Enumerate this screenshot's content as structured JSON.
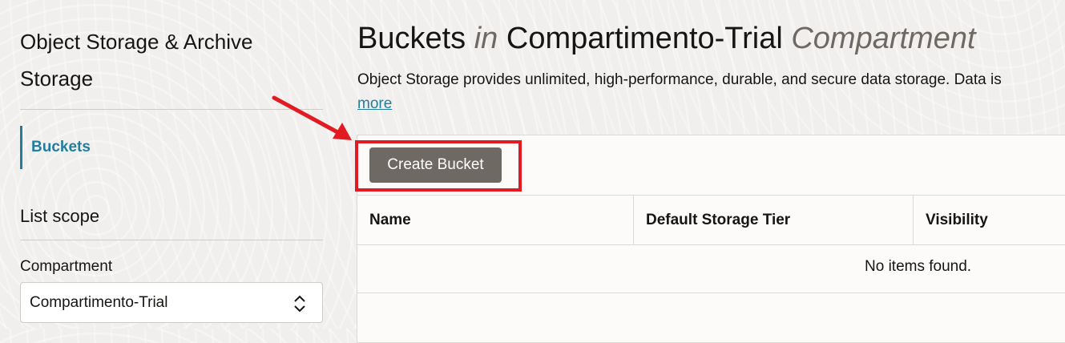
{
  "sidebar": {
    "title": "Object Storage & Archive Storage",
    "nav_items": [
      {
        "label": "Buckets",
        "active": true
      }
    ],
    "scope_heading": "List scope",
    "compartment_label": "Compartment",
    "compartment_value": "Compartimento-Trial"
  },
  "header": {
    "title_part1": "Buckets",
    "title_in": "in",
    "title_compartment": "Compartimento-Trial",
    "title_suffix": "Compartment",
    "description": "Object Storage provides unlimited, high-performance, durable, and secure data storage. Data is",
    "more_link": "more"
  },
  "toolbar": {
    "create_label": "Create Bucket"
  },
  "table": {
    "columns": [
      "Name",
      "Default Storage Tier",
      "Visibility"
    ],
    "empty_text": "No items found."
  },
  "colors": {
    "accent": "#227e9e",
    "highlight": "#e21b23",
    "button": "#6f6964"
  },
  "icons": {
    "select": "chevron-up-down-icon",
    "annotation": "red-arrow-icon"
  }
}
